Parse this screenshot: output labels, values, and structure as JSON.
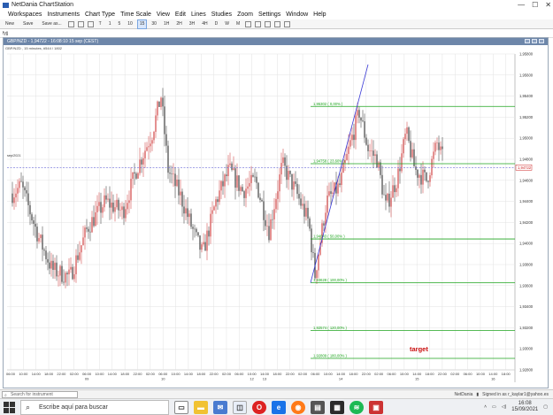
{
  "window": {
    "title": "NetDania ChartStation",
    "minimize": "—",
    "maximize": "☐",
    "close": "✕"
  },
  "menu": [
    "Workspaces",
    "Instruments",
    "Chart Type",
    "Time Scale",
    "View",
    "Edit",
    "Lines",
    "Studies",
    "Zoom",
    "Settings",
    "Window",
    "Help"
  ],
  "toolbar": {
    "new": "New",
    "save": "Save",
    "save_as": "Save as...",
    "timeframes": [
      "T",
      "1",
      "5",
      "10",
      "15",
      "30",
      "1H",
      "2H",
      "3H",
      "4H",
      "D",
      "W",
      "M"
    ],
    "active_timeframe": "15"
  },
  "subbar": {
    "label": "fyjj"
  },
  "chart": {
    "header": "GBP/NZD - 1,94722 - 16:08:10 15 sep (CEST)",
    "subheader": "GBP/NZD , 15 minutes, #544 / 1802",
    "date_label": "sep/2021"
  },
  "chart_data": {
    "type": "candlestick",
    "instrument": "GBP/NZD",
    "timeframe": "15 minutes",
    "last_price": "1,94722",
    "ylim": [
      1.928,
      1.958
    ],
    "y_ticks": [
      "1,95800",
      "1,95600",
      "1,95400",
      "1,95200",
      "1,95000",
      "1,94800",
      "1,94600",
      "1,94400",
      "1,94200",
      "1,94000",
      "1,93800",
      "1,93600",
      "1,93400",
      "1,93200",
      "1,93000",
      "1,92800"
    ],
    "x_time_labels": [
      "06:00",
      "10:00",
      "14:00",
      "18:00",
      "22:00",
      "02:00",
      "06:00",
      "10:00",
      "14:00",
      "18:00",
      "22:00",
      "02:00",
      "06:00",
      "10:00",
      "14:00",
      "18:00",
      "22:00",
      "02:00",
      "06:00",
      "10:00",
      "14:00",
      "18:00",
      "22:00",
      "02:00",
      "06:00",
      "10:00",
      "14:00",
      "18:00",
      "22:00",
      "02:00",
      "06:00",
      "10:00",
      "14:00",
      "18:00",
      "22:00",
      "02:00",
      "06:00",
      "10:00",
      "14:00",
      "18:00"
    ],
    "x_day_labels": [
      {
        "label": "09",
        "index": 6
      },
      {
        "label": "10",
        "index": 12
      },
      {
        "label": "12",
        "index": 19
      },
      {
        "label": "13",
        "index": 20
      },
      {
        "label": "14",
        "index": 26
      },
      {
        "label": "15",
        "index": 32
      },
      {
        "label": "16",
        "index": 38
      }
    ],
    "fib_levels": [
      {
        "label": "1,95302 ( 0,00% )",
        "price": 1.95302
      },
      {
        "label": "1,94758 ( 23,60% )",
        "price": 1.94758
      },
      {
        "label": "1,94043 ( 50,00% )",
        "price": 1.94043
      },
      {
        "label": "1,93628 ( 100,00% )",
        "price": 1.93628
      },
      {
        "label": "1,92574 ( 120,00% )",
        "price": 1.93174
      },
      {
        "label": "1,92809 ( 180,00% )",
        "price": 1.92909
      }
    ],
    "current_price_label": "1,94722",
    "annotation": "target",
    "colors": {
      "grid": "#e2e2e2",
      "up": "#d24545",
      "down": "#3f3f3f",
      "fib": "#1fa51f",
      "trend": "#3a3ad6",
      "price_line": "#6b6bd6",
      "annotation": "#cc1111"
    }
  },
  "bottombar": {
    "search_placeholder": "Search for instrument",
    "provider": "NetDania",
    "signed_in": "Signed in as r_kaylar1@yahoo.es"
  },
  "taskbar": {
    "search_placeholder": "Escribe aquí para buscar",
    "time": "16:08",
    "date": "15/09/2021"
  }
}
